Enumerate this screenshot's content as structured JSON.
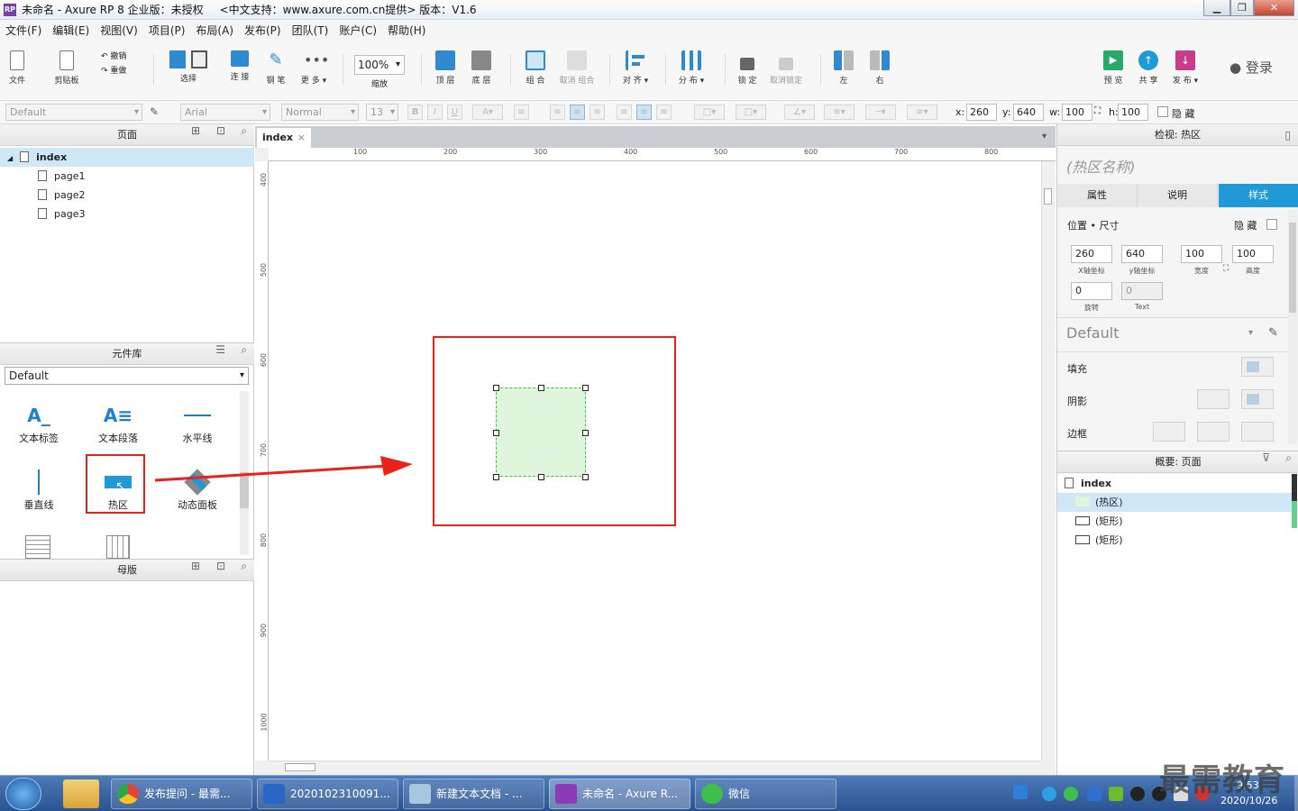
{
  "window": {
    "title": "未命名 - Axure RP 8 企业版：未授权",
    "subtitle": "<中文支持：www.axure.com.cn提供> 版本：V1.6",
    "app_icon": "RP"
  },
  "menu": [
    "文件(F)",
    "编辑(E)",
    "视图(V)",
    "项目(P)",
    "布局(A)",
    "发布(P)",
    "团队(T)",
    "账户(C)",
    "帮助(H)"
  ],
  "toolbar": {
    "file": "文件",
    "clipboard": "剪贴板",
    "undo": "撤销",
    "redo": "重做",
    "select": "选择",
    "connect": "连 接",
    "pen": "钢 笔",
    "more": "更 多 ▾",
    "zoom_value": "100%",
    "zoom": "缩放",
    "top": "顶 层",
    "bottom": "底 层",
    "group": "组 合",
    "ungroup": "取消 组合",
    "align": "对 齐 ▾",
    "distribute": "分 布 ▾",
    "lock": "锁 定",
    "unlock": "取消锁定",
    "left": "左",
    "right": "右",
    "preview": "预 览",
    "share": "共 享",
    "publish": "发 布 ▾",
    "login": "登录"
  },
  "format": {
    "style": "Default",
    "font": "Arial",
    "weight": "Normal",
    "size": "13",
    "x_label": "x:",
    "x": "260",
    "y_label": "y:",
    "y": "640",
    "w_label": "w:",
    "w": "100",
    "h_label": "h:",
    "h": "100",
    "hide": "隐 藏"
  },
  "pages_panel": {
    "title": "页面",
    "root": "index",
    "children": [
      "page1",
      "page2",
      "page3"
    ]
  },
  "library_panel": {
    "title": "元件库",
    "selected": "Default",
    "widgets": [
      "文本标签",
      "文本段落",
      "水平线",
      "垂直线",
      "热区",
      "动态面板"
    ]
  },
  "masters_panel": {
    "title": "母版"
  },
  "canvas": {
    "tab": "index",
    "h_ruler": [
      "100",
      "200",
      "300",
      "400",
      "500",
      "600",
      "700",
      "800"
    ],
    "v_ruler": [
      "400",
      "500",
      "600",
      "700",
      "800",
      "900",
      "1000"
    ]
  },
  "inspector": {
    "title": "检视: 热区",
    "name_placeholder": "(热区名称)",
    "tabs": [
      "属性",
      "说明",
      "样式"
    ],
    "active_tab": "样式",
    "section": "位置 • 尺寸",
    "hide": "隐 藏",
    "x": "260",
    "x_label": "X轴坐标",
    "y": "640",
    "y_label": "y轴坐标",
    "w": "100",
    "w_label": "宽度",
    "h": "100",
    "h_label": "高度",
    "rotation": "0",
    "rotation_label": "旋转",
    "text_rot": "0",
    "text_label": "Text",
    "style": "Default",
    "fill": "填充",
    "shadow": "阴影",
    "border": "边框"
  },
  "outline": {
    "title": "概要: 页面",
    "root": "index",
    "items": [
      "(热区)",
      "(矩形)",
      "(矩形)"
    ]
  },
  "taskbar": {
    "items": [
      "发布提问 - 最需...",
      "2020102310091...",
      "新建文本文档 - ...",
      "未命名 - Axure R...",
      "微信"
    ],
    "time": "9:53",
    "date": "2020/10/26",
    "watermark": "最需教育"
  },
  "colors": {
    "accent": "#1f9ad6",
    "highlight_red": "#e8221b",
    "hotspot_fill": "#dff6dc",
    "hotspot_border": "#3ec43e"
  }
}
